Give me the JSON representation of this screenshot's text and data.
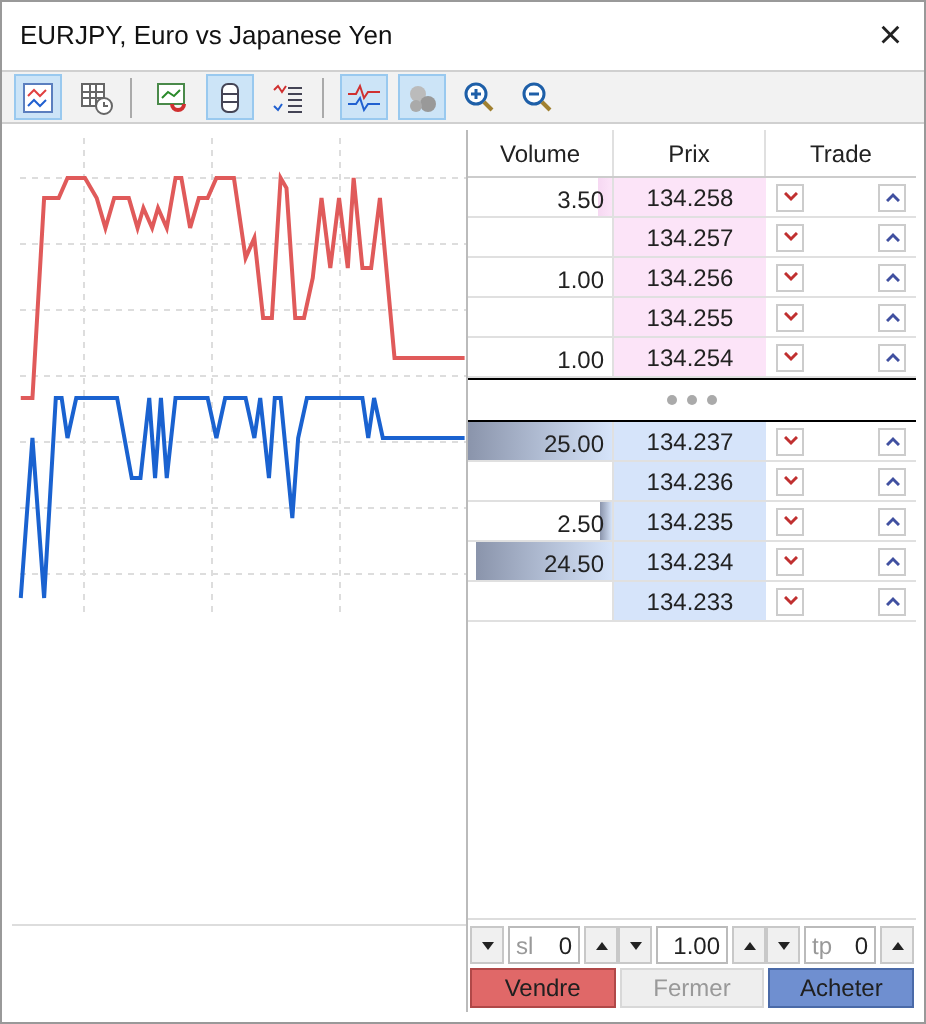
{
  "window": {
    "title": "EURJPY, Euro vs Japanese Yen",
    "close": "×"
  },
  "toolbar": [
    {
      "kind": "chart",
      "selected": true
    },
    {
      "kind": "table",
      "selected": false
    },
    {
      "kind": "magnet",
      "selected": false
    },
    {
      "kind": "cylinder",
      "selected": true
    },
    {
      "kind": "list",
      "selected": false
    },
    {
      "kind": "ticks",
      "selected": true
    },
    {
      "kind": "circles",
      "selected": true
    },
    {
      "kind": "zoom-in",
      "selected": false
    },
    {
      "kind": "zoom-out",
      "selected": false
    }
  ],
  "depth": {
    "columns": [
      "Volume",
      "Prix",
      "Trade"
    ],
    "rows": [
      {
        "kind": "ask",
        "volume": "3.50",
        "level": 0.1,
        "price": "134.258"
      },
      {
        "kind": "ask",
        "price": "134.257"
      },
      {
        "kind": "ask",
        "volume": "1.00",
        "price": "134.256"
      },
      {
        "kind": "ask",
        "price": "134.255"
      },
      {
        "kind": "ask",
        "volume": "1.00",
        "price": "134.254"
      },
      {
        "kind": "bid",
        "volume": "25.00",
        "level": 1,
        "price": "134.237"
      },
      {
        "kind": "bid",
        "price": "134.236"
      },
      {
        "kind": "bid",
        "volume": "2.50",
        "level": 0.08,
        "price": "134.235"
      },
      {
        "kind": "bid",
        "volume": "24.50",
        "level": 0.95,
        "price": "134.234"
      },
      {
        "kind": "bid",
        "price": "134.233"
      }
    ]
  },
  "controls": {
    "sl": {
      "placeholder": "sl",
      "value": "0"
    },
    "volume": {
      "value": "1.00"
    },
    "tp": {
      "placeholder": "tp",
      "value": "0"
    }
  },
  "buttons": [
    {
      "kind": "sell",
      "label": "Vendre",
      "disabled": false
    },
    {
      "kind": "close",
      "label": "Fermer",
      "disabled": true
    },
    {
      "kind": "buy",
      "label": "Acheter",
      "disabled": false
    }
  ]
}
